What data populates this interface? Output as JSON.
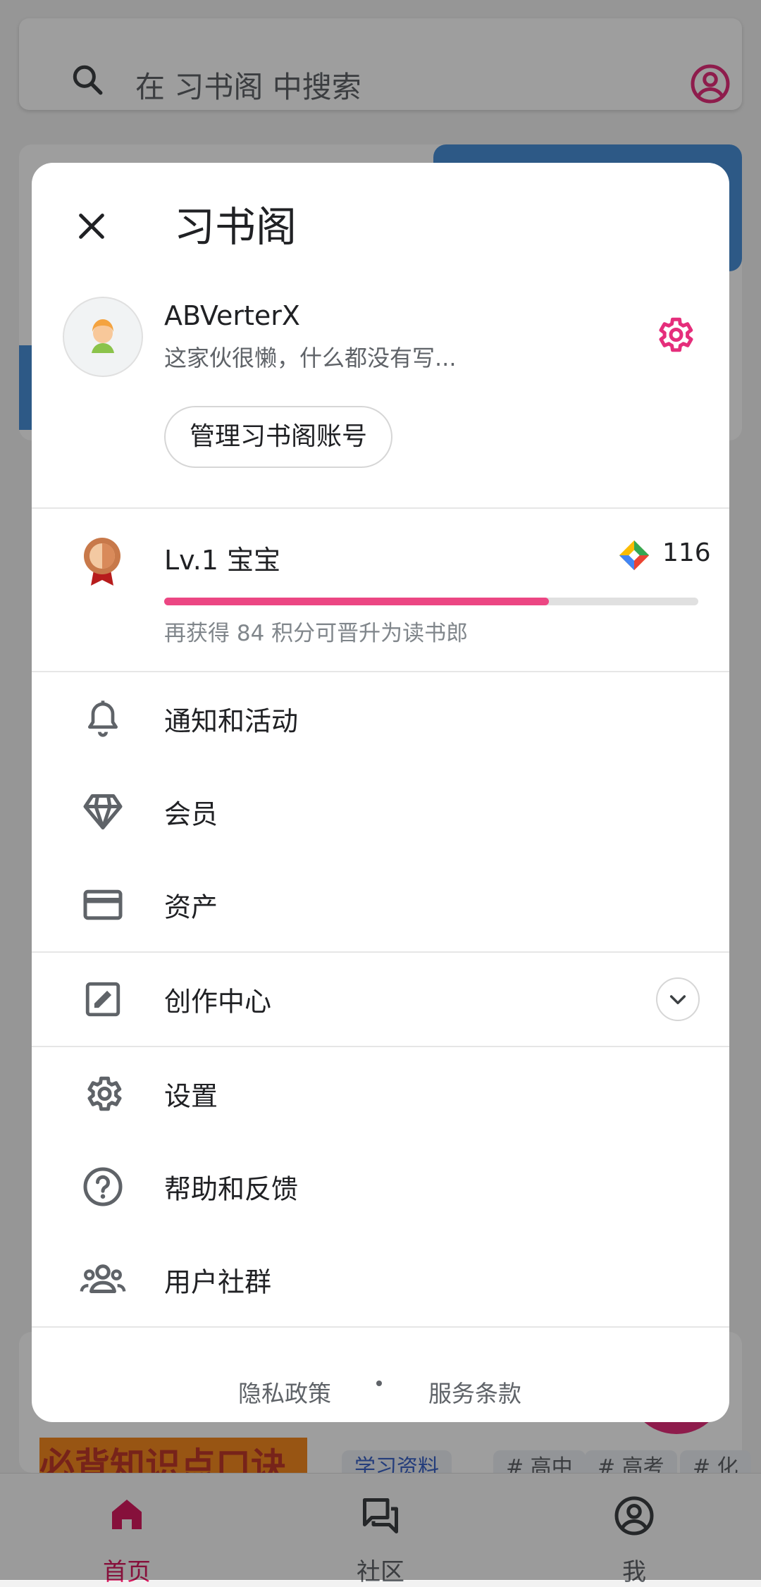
{
  "search": {
    "placeholder": "在 习书阁 中搜索"
  },
  "background": {
    "banner_text": "必背知识点口诀",
    "tags": [
      "学习资料",
      "# 高中",
      "# 高考",
      "# 化"
    ]
  },
  "bottom_nav": [
    {
      "label": "首页",
      "icon": "home-icon",
      "active": true
    },
    {
      "label": "社区",
      "icon": "forum-icon",
      "active": false
    },
    {
      "label": "我",
      "icon": "account-circle-icon",
      "active": false
    }
  ],
  "dialog": {
    "title": "习书阁",
    "profile": {
      "name": "ABVerterX",
      "bio": "这家伙很懒，什么都没有写...",
      "manage_button": "管理习书阁账号"
    },
    "level": {
      "label": "Lv.1 宝宝",
      "points": "116",
      "progress": 0.72,
      "hint": "再获得 84 积分可晋升为读书郎"
    },
    "menu_group1": [
      {
        "label": "通知和活动",
        "icon": "bell-icon"
      },
      {
        "label": "会员",
        "icon": "diamond-icon"
      },
      {
        "label": "资产",
        "icon": "credit-card-icon"
      }
    ],
    "creation": {
      "label": "创作中心",
      "icon": "edit-square-icon"
    },
    "menu_group2": [
      {
        "label": "设置",
        "icon": "settings-icon"
      },
      {
        "label": "帮助和反馈",
        "icon": "help-circle-icon"
      },
      {
        "label": "用户社群",
        "icon": "group-icon"
      }
    ],
    "footer": {
      "privacy": "隐私政策",
      "terms": "服务条款"
    }
  },
  "colors": {
    "accent": "#e52e7b",
    "progress": "#ec4683",
    "text": "#202124",
    "muted": "#5f6368"
  }
}
